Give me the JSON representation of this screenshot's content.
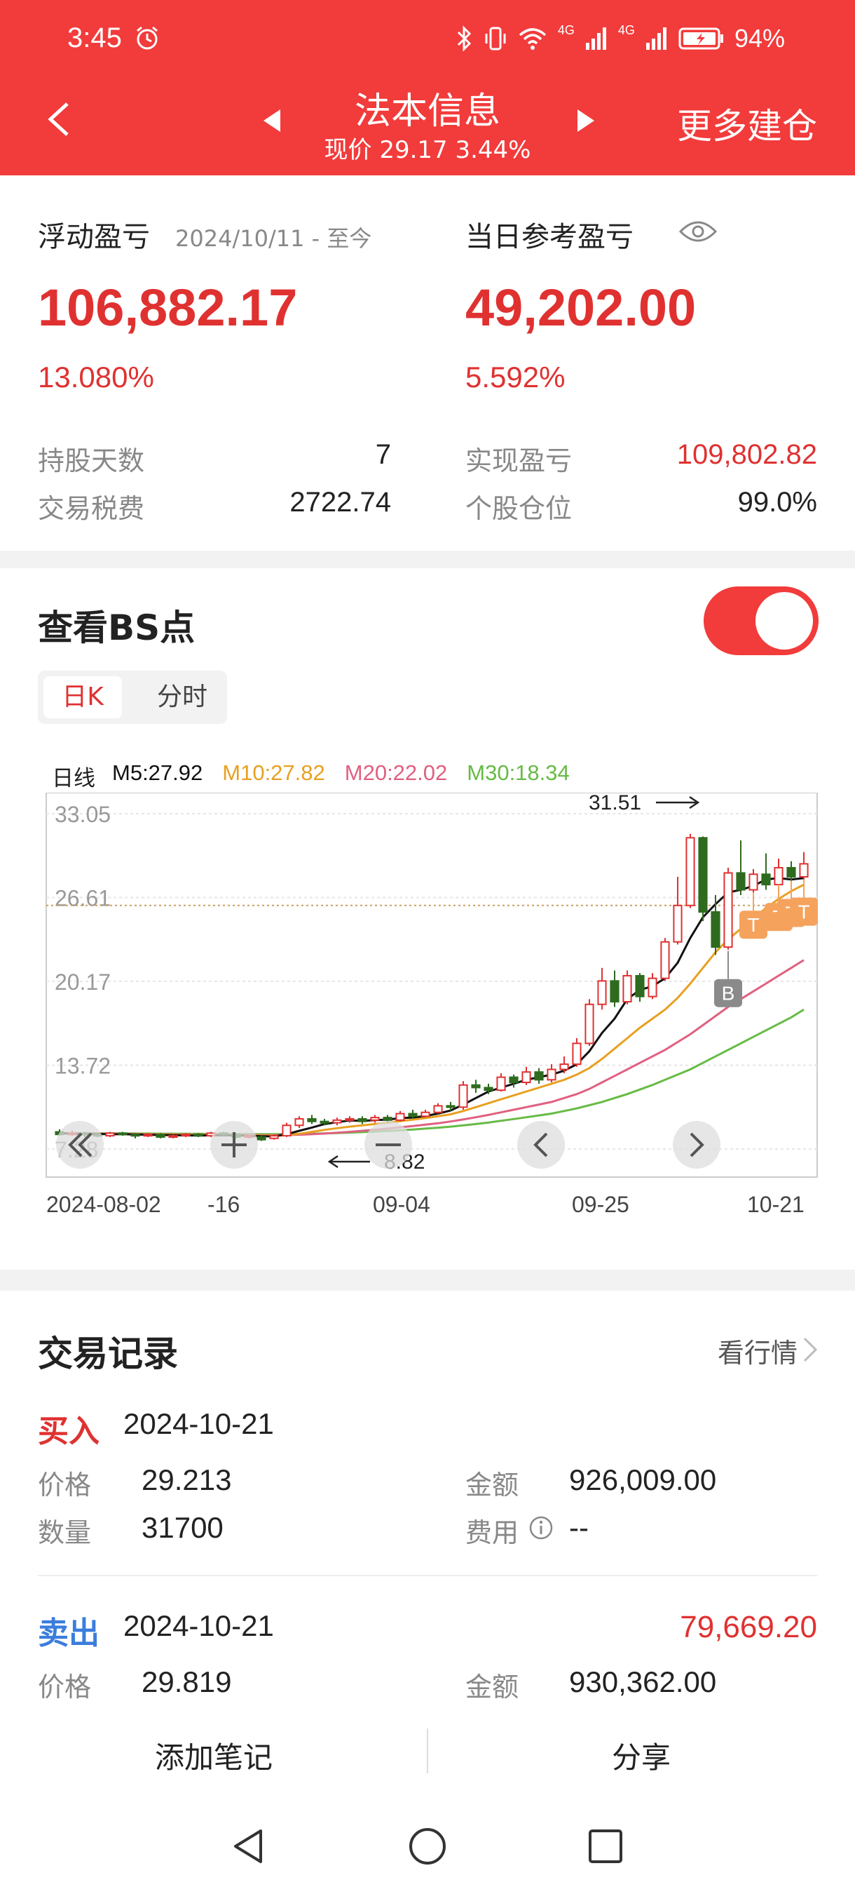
{
  "status_bar": {
    "time": "3:45",
    "network_label_1": "4G",
    "network_label_2": "4G",
    "battery": "94%"
  },
  "header": {
    "title": "法本信息",
    "subtitle": "现价 29.17 3.44%",
    "more": "更多建仓"
  },
  "summary": {
    "float_label": "浮动盈亏",
    "float_range": "2024/10/11 - 至今",
    "float_value": "106,882.17",
    "float_pct": "13.080%",
    "today_label": "当日参考盈亏",
    "today_value": "49,202.00",
    "today_pct": "5.592%",
    "hold_days_label": "持股天数",
    "hold_days": "7",
    "tax_label": "交易税费",
    "tax": "2722.74",
    "realized_label": "实现盈亏",
    "realized": "109,802.82",
    "position_label": "个股仓位",
    "position": "99.0%"
  },
  "bs": {
    "title": "查看BS点",
    "toggle_on": true,
    "tab_day": "日K",
    "tab_minute": "分时"
  },
  "ma_legend": {
    "daily": "日线",
    "m5": "M5:27.92",
    "m10": "M10:27.82",
    "m20": "M20:22.02",
    "m30": "M30:18.34"
  },
  "chart_data": {
    "type": "candlestick",
    "y_ticks": [
      "33.05",
      "26.61",
      "20.17",
      "13.72",
      "7.28"
    ],
    "ylim": [
      7.28,
      33.05
    ],
    "x_ticks": [
      "2024-08-02",
      "-16",
      "09-04",
      "09-25",
      "10-21"
    ],
    "high_annotation": "31.51",
    "low_annotation": "8.82",
    "reference_price": 26.0,
    "candles": [
      [
        8.6,
        8.4,
        8.8,
        8.3
      ],
      [
        8.4,
        8.5,
        8.7,
        8.3
      ],
      [
        8.5,
        8.4,
        8.6,
        8.2
      ],
      [
        8.4,
        8.3,
        8.5,
        8.2
      ],
      [
        8.3,
        8.5,
        8.6,
        8.2
      ],
      [
        8.5,
        8.4,
        8.6,
        8.3
      ],
      [
        8.4,
        8.3,
        8.5,
        8.1
      ],
      [
        8.3,
        8.4,
        8.5,
        8.2
      ],
      [
        8.4,
        8.2,
        8.5,
        8.1
      ],
      [
        8.2,
        8.3,
        8.4,
        8.1
      ],
      [
        8.3,
        8.4,
        8.5,
        8.2
      ],
      [
        8.4,
        8.3,
        8.5,
        8.2
      ],
      [
        8.3,
        8.5,
        8.6,
        8.2
      ],
      [
        8.5,
        8.4,
        8.6,
        8.3
      ],
      [
        8.4,
        8.2,
        8.5,
        8.1
      ],
      [
        8.2,
        8.3,
        8.4,
        8.1
      ],
      [
        8.2,
        8.0,
        8.3,
        7.9
      ],
      [
        8.1,
        8.3,
        8.4,
        8.0
      ],
      [
        8.3,
        9.1,
        9.3,
        8.2
      ],
      [
        9.1,
        9.6,
        9.8,
        8.9
      ],
      [
        9.6,
        9.4,
        9.9,
        9.2
      ],
      [
        9.4,
        9.3,
        9.6,
        9.1
      ],
      [
        9.3,
        9.5,
        9.7,
        9.1
      ],
      [
        9.5,
        9.6,
        9.8,
        9.3
      ],
      [
        9.6,
        9.4,
        9.8,
        9.2
      ],
      [
        9.5,
        9.7,
        9.9,
        9.3
      ],
      [
        9.7,
        9.5,
        9.9,
        9.3
      ],
      [
        9.5,
        10.0,
        10.2,
        9.4
      ],
      [
        10.0,
        9.8,
        10.3,
        9.6
      ],
      [
        9.8,
        10.1,
        10.3,
        9.7
      ],
      [
        10.1,
        10.6,
        10.8,
        10.0
      ],
      [
        10.6,
        10.5,
        10.9,
        10.2
      ],
      [
        10.5,
        12.2,
        12.5,
        10.3
      ],
      [
        12.2,
        12.0,
        12.6,
        11.6
      ],
      [
        12.0,
        11.8,
        12.3,
        11.5
      ],
      [
        11.8,
        12.8,
        13.1,
        11.7
      ],
      [
        12.8,
        12.4,
        13.0,
        12.0
      ],
      [
        12.4,
        13.2,
        13.6,
        12.2
      ],
      [
        13.2,
        12.6,
        13.5,
        12.3
      ],
      [
        12.6,
        13.4,
        13.8,
        12.4
      ],
      [
        13.4,
        13.8,
        14.4,
        13.1
      ],
      [
        13.8,
        15.4,
        15.8,
        13.6
      ],
      [
        15.4,
        18.4,
        18.8,
        15.2
      ],
      [
        18.4,
        20.2,
        21.2,
        18.0
      ],
      [
        20.2,
        18.6,
        21.0,
        18.2
      ],
      [
        18.6,
        20.6,
        21.0,
        18.4
      ],
      [
        20.6,
        19.0,
        20.8,
        18.6
      ],
      [
        19.0,
        20.4,
        20.8,
        18.8
      ],
      [
        20.4,
        23.2,
        23.5,
        20.2
      ],
      [
        23.2,
        26.0,
        28.2,
        23.0
      ],
      [
        26.0,
        31.2,
        31.5,
        25.8
      ],
      [
        31.2,
        25.5,
        31.3,
        24.8
      ],
      [
        25.5,
        22.8,
        26.8,
        22.2
      ],
      [
        22.8,
        28.5,
        28.9,
        22.6
      ],
      [
        28.5,
        27.2,
        31.0,
        26.8
      ],
      [
        27.2,
        28.4,
        28.8,
        27.0
      ],
      [
        28.4,
        27.6,
        30.0,
        27.2
      ],
      [
        27.6,
        28.9,
        29.6,
        27.4
      ],
      [
        28.9,
        28.2,
        29.4,
        27.9
      ],
      [
        28.2,
        29.2,
        30.1,
        28.0
      ]
    ],
    "ma5": [
      8.5,
      8.45,
      8.45,
      8.44,
      8.42,
      8.42,
      8.4,
      8.38,
      8.36,
      8.34,
      8.33,
      8.32,
      8.33,
      8.34,
      8.33,
      8.3,
      8.26,
      8.25,
      8.42,
      8.68,
      8.93,
      9.2,
      9.34,
      9.48,
      9.44,
      9.5,
      9.54,
      9.66,
      9.7,
      9.82,
      10.0,
      10.24,
      10.7,
      11.2,
      11.7,
      12.0,
      12.3,
      12.6,
      12.8,
      13.0,
      13.3,
      13.8,
      14.8,
      16.2,
      17.3,
      18.8,
      19.5,
      19.8,
      20.4,
      21.6,
      23.5,
      25.1,
      26.1,
      27.0,
      27.2,
      27.5,
      28.0,
      28.1,
      28.0,
      28.1
    ],
    "ma10": [
      8.5,
      8.48,
      8.46,
      8.45,
      8.44,
      8.43,
      8.42,
      8.41,
      8.4,
      8.39,
      8.38,
      8.36,
      8.35,
      8.35,
      8.34,
      8.33,
      8.32,
      8.3,
      8.35,
      8.45,
      8.6,
      8.75,
      8.88,
      9.0,
      9.1,
      9.2,
      9.3,
      9.42,
      9.54,
      9.66,
      9.8,
      9.95,
      10.2,
      10.5,
      10.8,
      11.1,
      11.4,
      11.7,
      12.0,
      12.3,
      12.6,
      13.0,
      13.5,
      14.2,
      15.0,
      15.8,
      16.6,
      17.3,
      18.0,
      18.9,
      20.0,
      21.2,
      22.4,
      23.4,
      24.2,
      25.0,
      25.8,
      26.5,
      27.1,
      27.6
    ],
    "ma20": [
      8.5,
      8.49,
      8.48,
      8.47,
      8.46,
      8.45,
      8.44,
      8.43,
      8.42,
      8.41,
      8.4,
      8.39,
      8.38,
      8.37,
      8.36,
      8.36,
      8.35,
      8.35,
      8.36,
      8.38,
      8.42,
      8.47,
      8.53,
      8.6,
      8.68,
      8.76,
      8.85,
      8.95,
      9.05,
      9.15,
      9.26,
      9.4,
      9.55,
      9.72,
      9.9,
      10.1,
      10.3,
      10.5,
      10.7,
      10.9,
      11.2,
      11.5,
      11.9,
      12.4,
      12.9,
      13.4,
      13.9,
      14.4,
      14.9,
      15.5,
      16.1,
      16.8,
      17.5,
      18.2,
      18.8,
      19.4,
      20.0,
      20.6,
      21.2,
      21.8
    ],
    "ma30": [
      8.5,
      8.5,
      8.49,
      8.49,
      8.48,
      8.48,
      8.47,
      8.47,
      8.46,
      8.46,
      8.45,
      8.45,
      8.44,
      8.44,
      8.43,
      8.43,
      8.42,
      8.42,
      8.43,
      8.44,
      8.46,
      8.48,
      8.51,
      8.54,
      8.58,
      8.62,
      8.67,
      8.72,
      8.78,
      8.85,
      8.92,
      9.0,
      9.1,
      9.2,
      9.32,
      9.45,
      9.58,
      9.72,
      9.86,
      10.0,
      10.2,
      10.4,
      10.65,
      10.9,
      11.2,
      11.5,
      11.85,
      12.2,
      12.6,
      13.0,
      13.4,
      13.9,
      14.4,
      14.9,
      15.4,
      15.9,
      16.4,
      16.9,
      17.4,
      18.0
    ],
    "markers": [
      {
        "label": "B",
        "index": 53,
        "price": 22.5,
        "kind": "buy"
      },
      {
        "label": "T",
        "index": 55,
        "price": 27.0,
        "kind": "t"
      },
      {
        "label": "T",
        "index": 57,
        "price": 27.6,
        "kind": "t"
      },
      {
        "label": "T",
        "index": 58,
        "price": 27.9,
        "kind": "t"
      },
      {
        "label": "T",
        "index": 59,
        "price": 28.0,
        "kind": "t"
      }
    ],
    "colors": {
      "up": "#e03131",
      "down": "#2e6b1f",
      "ma5": "#111111",
      "ma10": "#e8a020",
      "ma20": "#e06080",
      "ma30": "#66bb44"
    }
  },
  "trades": {
    "title": "交易记录",
    "link": "看行情",
    "buy": {
      "tag": "买入",
      "date": "2024-10-21",
      "price_label": "价格",
      "price": "29.213",
      "qty_label": "数量",
      "qty": "31700",
      "amount_label": "金额",
      "amount": "926,009.00",
      "fee_label": "费用",
      "fee": "--"
    },
    "sell": {
      "tag": "卖出",
      "date": "2024-10-21",
      "profit": "79,669.20",
      "price_label": "价格",
      "price": "29.819",
      "amount_label": "金额",
      "amount": "930,362.00"
    }
  },
  "actions": {
    "note": "添加笔记",
    "share": "分享"
  }
}
